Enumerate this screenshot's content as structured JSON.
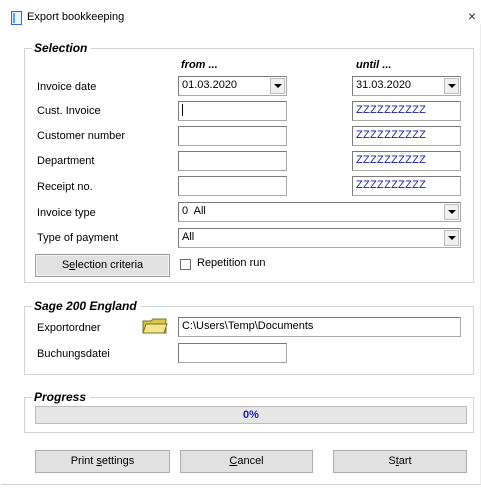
{
  "window": {
    "title": "Export bookkeeping",
    "close_glyph": "×"
  },
  "selection": {
    "legend": "Selection",
    "col_from": "from ...",
    "col_until": "until ...",
    "invoice_date": {
      "label": "Invoice date",
      "from": "01.03.2020",
      "until": "31.03.2020"
    },
    "cust_invoice": {
      "label": "Cust. Invoice",
      "from": "",
      "until": "ZZZZZZZZZZ"
    },
    "customer_number": {
      "label": "Customer number",
      "from": "",
      "until": "ZZZZZZZZZZ"
    },
    "department": {
      "label": "Department",
      "from": "",
      "until": "ZZZZZZZZZZ"
    },
    "receipt_no": {
      "label": "Receipt no.",
      "from": "",
      "until": "ZZZZZZZZZZ"
    },
    "invoice_type": {
      "label": "Invoice type",
      "value": "0  All"
    },
    "type_of_payment": {
      "label": "Type of payment",
      "value": "All"
    },
    "criteria_button": {
      "pre": "S",
      "accel": "e",
      "post": "lection criteria"
    },
    "repetition_run": {
      "label": "Repetition run",
      "checked": false
    }
  },
  "sage": {
    "legend": "Sage 200 England",
    "export_folder_label": "Exportordner",
    "export_folder_value": "C:\\Users\\Temp\\Documents",
    "booking_file_label": "Buchungsdatei",
    "booking_file_value": ""
  },
  "progress": {
    "legend": "Progress",
    "text": "0%",
    "value": 0
  },
  "buttons": {
    "print": {
      "pre": "Print ",
      "accel": "s",
      "post": "ettings"
    },
    "cancel": {
      "pre": "",
      "accel": "C",
      "post": "ancel"
    },
    "start": {
      "pre": "S",
      "accel": "t",
      "post": "art"
    }
  },
  "icons": {
    "app": "app-window-icon",
    "folder": "folder-icon",
    "dropdown": "chevron-down-icon"
  },
  "colors": {
    "field_text_blue": "#1b1b9a",
    "progress_text": "#1f1fa3",
    "button_face": "#e1e1e1",
    "folder_yellow": "#e8d86a"
  }
}
